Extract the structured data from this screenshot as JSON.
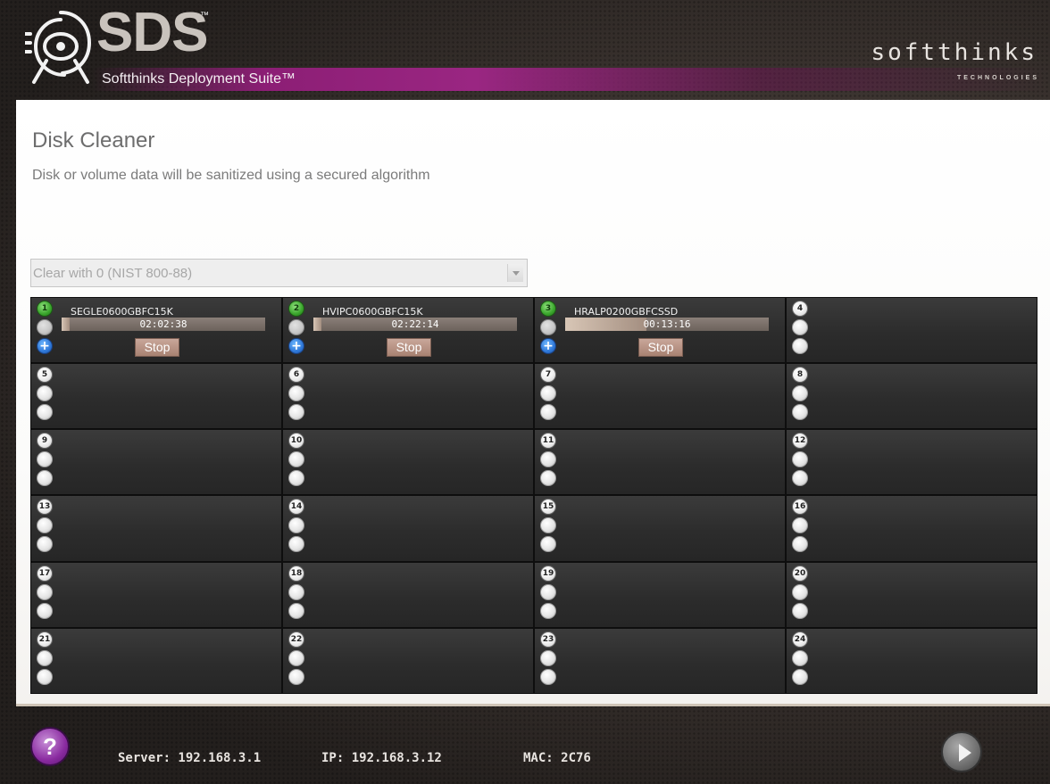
{
  "header": {
    "logo_mark": "SDS",
    "logo_tm": "™",
    "suite_name": "Softthinks Deployment Suite™",
    "brand": "softthinks",
    "brand_sub": "TECHNOLOGIES"
  },
  "main": {
    "title": "Disk Cleaner",
    "subtitle": "Disk or volume data will be sanitized using a secured algorithm",
    "method_select": {
      "value": "Clear with 0 (NIST 800-88)"
    }
  },
  "slots": [
    {
      "number": "1",
      "status": "active",
      "disk": "SEGLE0600GBFC15K",
      "time": "02:02:38",
      "progress": 0.04,
      "stop_label": "Stop"
    },
    {
      "number": "2",
      "status": "active",
      "disk": "HVIPC0600GBFC15K",
      "time": "02:22:14",
      "progress": 0.04,
      "stop_label": "Stop"
    },
    {
      "number": "3",
      "status": "active",
      "disk": "HRALP0200GBFCSSD",
      "time": "00:13:16",
      "progress": 0.4,
      "stop_label": "Stop"
    },
    {
      "number": "4"
    },
    {
      "number": "5"
    },
    {
      "number": "6"
    },
    {
      "number": "7"
    },
    {
      "number": "8"
    },
    {
      "number": "9"
    },
    {
      "number": "10"
    },
    {
      "number": "11"
    },
    {
      "number": "12"
    },
    {
      "number": "13"
    },
    {
      "number": "14"
    },
    {
      "number": "15"
    },
    {
      "number": "16"
    },
    {
      "number": "17"
    },
    {
      "number": "18"
    },
    {
      "number": "19"
    },
    {
      "number": "20"
    },
    {
      "number": "21"
    },
    {
      "number": "22"
    },
    {
      "number": "23"
    },
    {
      "number": "24"
    }
  ],
  "footer": {
    "help_label": "?",
    "server": "Server: 192.168.3.1",
    "ip": "IP: 192.168.3.12",
    "mac": "MAC: 2C76"
  },
  "colors": {
    "accent_purple": "#8c1e75",
    "active_green": "#3aa52c",
    "plus_blue": "#2f78d8"
  }
}
